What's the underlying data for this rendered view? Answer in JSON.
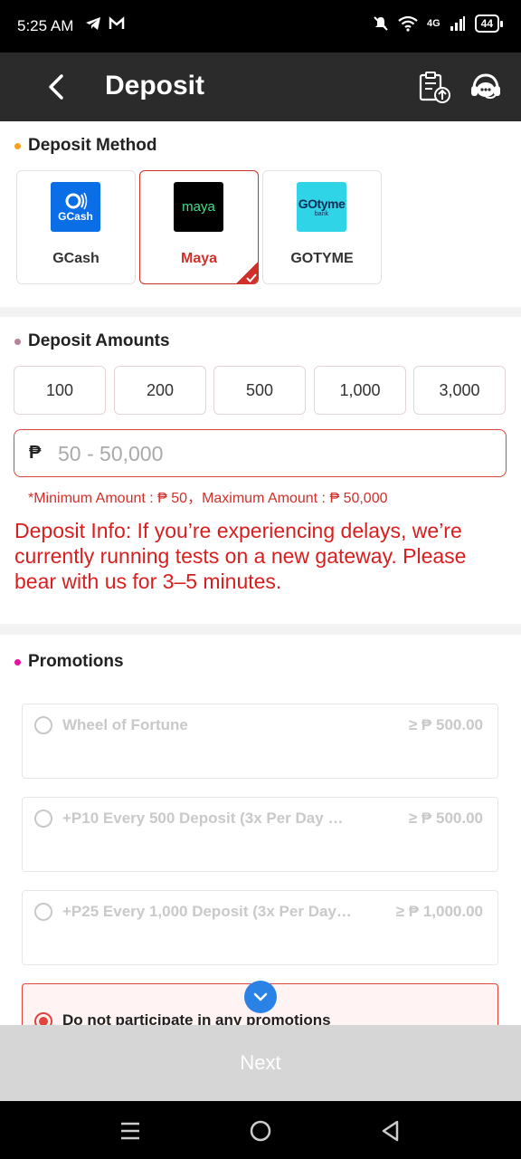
{
  "status_bar": {
    "time": "5:25 AM",
    "network": "4G",
    "battery": "44"
  },
  "header": {
    "title": "Deposit"
  },
  "deposit_method": {
    "title": "Deposit Method",
    "methods": [
      {
        "label": "GCash",
        "logo_text": "GCash",
        "color": "#0a6ee6",
        "selected": false
      },
      {
        "label": "Maya",
        "logo_text": "maya",
        "color": "#000000",
        "selected": true
      },
      {
        "label": "GOTYME",
        "logo_text": "GOtyme",
        "logo_sub": "bank",
        "color": "#2fd4e6",
        "selected": false
      }
    ]
  },
  "deposit_amounts": {
    "title": "Deposit Amounts",
    "presets": [
      "100",
      "200",
      "500",
      "1,000",
      "3,000"
    ],
    "currency_symbol": "₱",
    "placeholder": "50 - 50,000",
    "limits_text": "*Minimum Amount : ₱ 50，Maximum Amount : ₱ 50,000",
    "info": "Deposit Info: If you’re experiencing delays, we’re currently running tests on a new gateway. Please bear with us for 3–5 minutes."
  },
  "promotions": {
    "title": "Promotions",
    "items": [
      {
        "name": "Wheel of Fortune",
        "min": "≥ ₱ 500.00",
        "selected": false
      },
      {
        "name": "+P10 Every 500 Deposit (3x Per Day & No ...",
        "min": "≥ ₱ 500.00",
        "selected": false
      },
      {
        "name": "+P25 Every 1,000 Deposit (3x Per Day &...",
        "min": "≥ ₱ 1,000.00",
        "selected": false
      },
      {
        "name": "Do not participate in any promotions",
        "min": "",
        "selected": true
      }
    ]
  },
  "next_button": "Next",
  "colors": {
    "accent": "#d0302a",
    "header_bg": "#2b2b2b",
    "expand": "#2b82e6"
  }
}
